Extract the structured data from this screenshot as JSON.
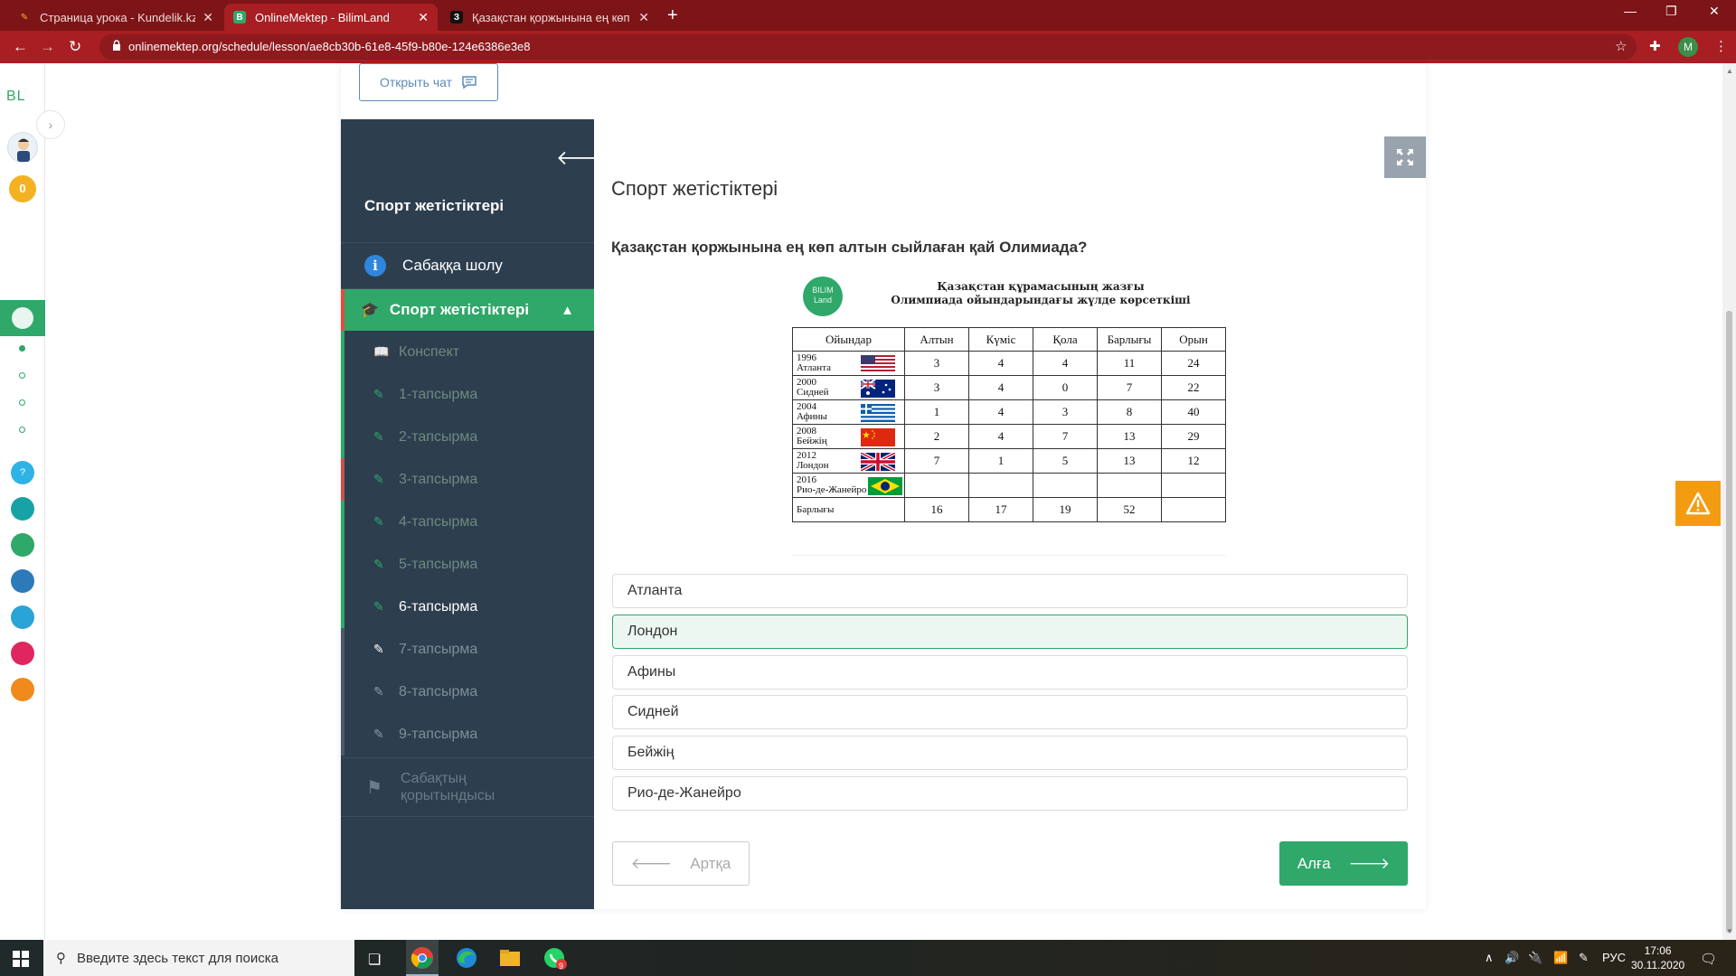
{
  "browser": {
    "tabs": [
      {
        "title": "Страница урока - Kundelik.kz",
        "active": false
      },
      {
        "title": "OnlineMektep - BilimLand",
        "active": true
      },
      {
        "title": "Қазақстан қоржынына ең көп а",
        "active": false
      }
    ],
    "url": "onlinemektep.org/schedule/lesson/ae8cb30b-61e8-45f9-b80e-124e6386e3e8",
    "profile_initial": "M"
  },
  "rail": {
    "logo": "BL",
    "coins": "0"
  },
  "chat_button": "Открыть чат",
  "lesson": {
    "title": "Спорт жетістіктері",
    "overview": "Сабаққа шолу",
    "section": "Спорт жетістіктері",
    "tasks": [
      {
        "label": "Конспект",
        "state": "done"
      },
      {
        "label": "1-тапсырма",
        "state": "done"
      },
      {
        "label": "2-тапсырма",
        "state": "done"
      },
      {
        "label": "3-тапсырма",
        "state": "wrong"
      },
      {
        "label": "4-тапсырма",
        "state": "done"
      },
      {
        "label": "5-тапсырма",
        "state": "done"
      },
      {
        "label": "6-тапсырма",
        "state": "current"
      },
      {
        "label": "7-тапсырма",
        "state": "next"
      },
      {
        "label": "8-тапсырма",
        "state": "todo"
      },
      {
        "label": "9-тапсырма",
        "state": "todo"
      }
    ],
    "summary": "Сабақтың қорытындысы"
  },
  "content": {
    "title": "Спорт жетістіктері",
    "question": "Қазақстан қоржынына ең көп алтын сыйлаған қай Олимиада?",
    "figure": {
      "logo": "BILIM Land",
      "title_line1": "Қазақстан құрамасының жазғы",
      "title_line2": "Олимпиада ойындарындағы жүлде көрсеткіші",
      "headers": [
        "Ойындар",
        "Алтын",
        "Күміс",
        "Қола",
        "Барлығы",
        "Орын"
      ],
      "rows": [
        {
          "year": "1996",
          "city": "Атланта",
          "flag": "usa",
          "values": [
            "3",
            "4",
            "4",
            "11",
            "24"
          ]
        },
        {
          "year": "2000",
          "city": "Сидней",
          "flag": "australia",
          "values": [
            "3",
            "4",
            "0",
            "7",
            "22"
          ]
        },
        {
          "year": "2004",
          "city": "Афины",
          "flag": "greece",
          "values": [
            "1",
            "4",
            "3",
            "8",
            "40"
          ]
        },
        {
          "year": "2008",
          "city": "Бейжің",
          "flag": "china",
          "values": [
            "2",
            "4",
            "7",
            "13",
            "29"
          ]
        },
        {
          "year": "2012",
          "city": "Лондон",
          "flag": "uk",
          "values": [
            "7",
            "1",
            "5",
            "13",
            "12"
          ]
        },
        {
          "year": "2016",
          "city": "Рио-де-Жанейро",
          "flag": "brazil",
          "values": [
            "",
            "",
            "",
            "",
            ""
          ]
        }
      ],
      "total_label": "Барлығы",
      "totals": [
        "16",
        "17",
        "19",
        "52",
        ""
      ]
    },
    "answers": [
      {
        "label": "Атланта",
        "selected": false
      },
      {
        "label": "Лондон",
        "selected": true
      },
      {
        "label": "Афины",
        "selected": false
      },
      {
        "label": "Сидней",
        "selected": false
      },
      {
        "label": "Бейжің",
        "selected": false
      },
      {
        "label": "Рио-де-Жанейро",
        "selected": false
      }
    ],
    "back_button": "Артқа",
    "next_button": "Алға"
  },
  "taskbar": {
    "search_placeholder": "Введите здесь текст для поиска",
    "whatsapp_badge": "9",
    "language": "РУС",
    "time": "17:06",
    "date": "30.11.2020"
  },
  "colors": {
    "accent_green": "#2fa86a",
    "sidebar_dark": "#2d3e4f",
    "browser_red": "#a81e22"
  }
}
